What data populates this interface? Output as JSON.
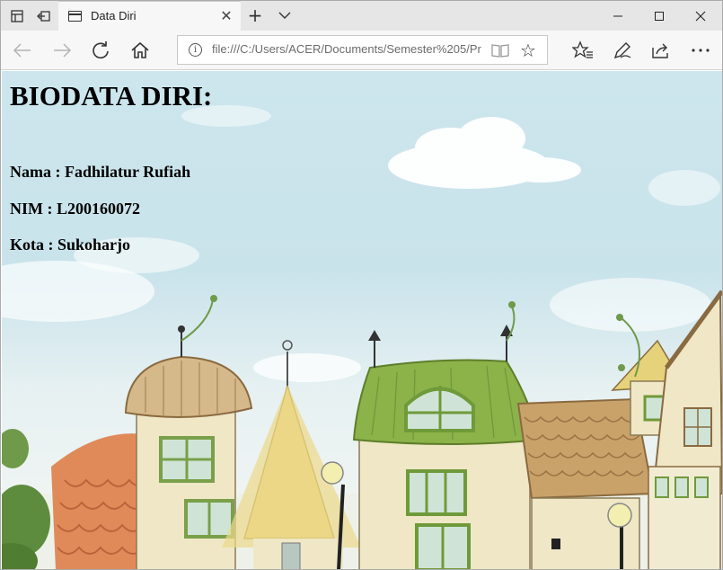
{
  "browser": {
    "tab_title": "Data Diri",
    "address_url": "file:///C:/Users/ACER/Documents/Semester%205/Pra",
    "icons": {
      "set_aside": "set-aside-tabs-icon",
      "show_set_aside": "show-tabs-aside-icon",
      "page": "page-icon",
      "close_tab": "close-icon",
      "new_tab": "plus-icon",
      "tab_list": "chevron-down-icon",
      "minimize": "minimize-icon",
      "maximize": "maximize-icon",
      "close_window": "close-icon",
      "back": "back-arrow-icon",
      "forward": "forward-arrow-icon",
      "refresh": "refresh-icon",
      "home": "home-icon",
      "info": "info-icon",
      "reading_view": "reading-view-icon",
      "favorite": "star-icon",
      "favorites_hub": "favorites-icon",
      "web_note": "pen-icon",
      "share": "share-icon",
      "more": "more-icon"
    }
  },
  "page": {
    "title": "BIODATA DIRI:",
    "nama": "Nama : Fadhilatur Rufiah",
    "nim": "NIM : L200160072",
    "kota": "Kota : Sukoharjo"
  },
  "colors": {
    "sky": "#cde6ee",
    "roof_green": "#8cb24a",
    "roof_orange": "#e08a5a",
    "roof_brown": "#c9a26a",
    "roof_yellow": "#e6d27a",
    "wall": "#efe7c6"
  }
}
